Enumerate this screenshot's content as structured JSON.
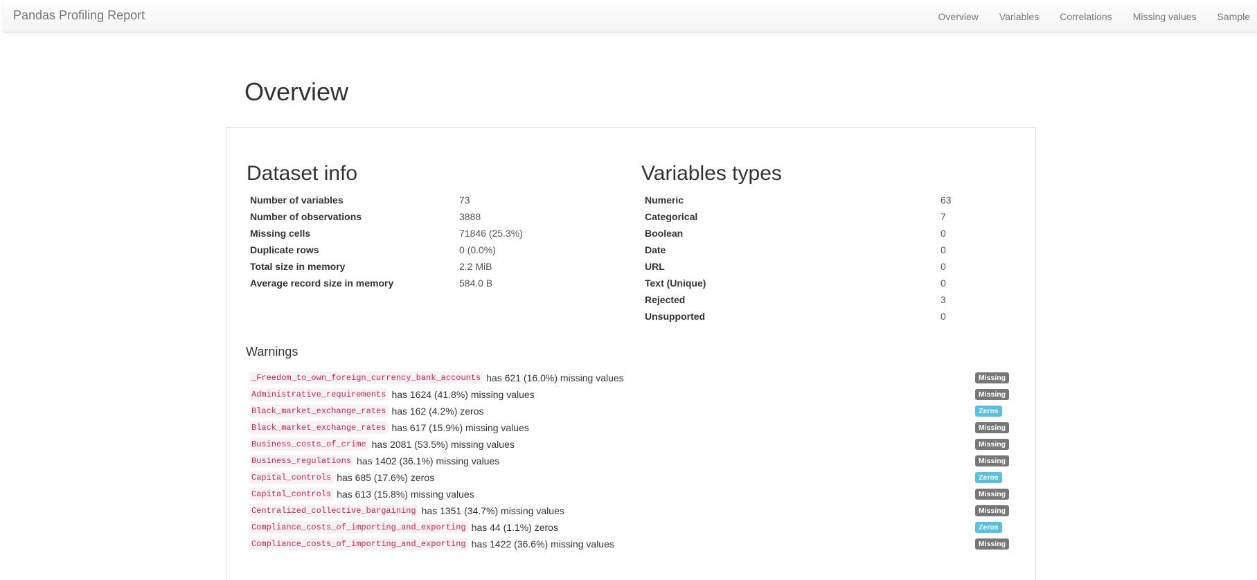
{
  "navbar": {
    "brand": "Pandas Profiling Report",
    "links": [
      "Overview",
      "Variables",
      "Correlations",
      "Missing values",
      "Sample"
    ]
  },
  "overview": {
    "title": "Overview",
    "dataset_info": {
      "title": "Dataset info",
      "rows": [
        {
          "label": "Number of variables",
          "value": "73"
        },
        {
          "label": "Number of observations",
          "value": "3888"
        },
        {
          "label": "Missing cells",
          "value": "71846 (25.3%)"
        },
        {
          "label": "Duplicate rows",
          "value": "0 (0.0%)"
        },
        {
          "label": "Total size in memory",
          "value": "2.2 MiB"
        },
        {
          "label": "Average record size in memory",
          "value": "584.0 B"
        }
      ]
    },
    "variable_types": {
      "title": "Variables types",
      "rows": [
        {
          "label": "Numeric",
          "value": "63"
        },
        {
          "label": "Categorical",
          "value": "7"
        },
        {
          "label": "Boolean",
          "value": "0"
        },
        {
          "label": "Date",
          "value": "0"
        },
        {
          "label": "URL",
          "value": "0"
        },
        {
          "label": "Text (Unique)",
          "value": "0"
        },
        {
          "label": "Rejected",
          "value": "3"
        },
        {
          "label": "Unsupported",
          "value": "0"
        }
      ]
    },
    "warnings": {
      "title": "Warnings",
      "items": [
        {
          "var": "_Freedom_to_own_foreign_currency_bank_accounts",
          "text": "has 621 (16.0%) missing values",
          "badge": "Missing",
          "kind": "missing"
        },
        {
          "var": "Administrative_requirements",
          "text": "has 1624 (41.8%) missing values",
          "badge": "Missing",
          "kind": "missing"
        },
        {
          "var": "Black_market_exchange_rates",
          "text": "has 162 (4.2%) zeros",
          "badge": "Zeros",
          "kind": "zeros"
        },
        {
          "var": "Black_market_exchange_rates",
          "text": "has 617 (15.9%) missing values",
          "badge": "Missing",
          "kind": "missing"
        },
        {
          "var": "Business_costs_of_crime",
          "text": "has 2081 (53.5%) missing values",
          "badge": "Missing",
          "kind": "missing"
        },
        {
          "var": "Business_regulations",
          "text": "has 1402 (36.1%) missing values",
          "badge": "Missing",
          "kind": "missing"
        },
        {
          "var": "Capital_controls",
          "text": "has 685 (17.6%) zeros",
          "badge": "Zeros",
          "kind": "zeros"
        },
        {
          "var": "Capital_controls",
          "text": "has 613 (15.8%) missing values",
          "badge": "Missing",
          "kind": "missing"
        },
        {
          "var": "Centralized_collective_bargaining",
          "text": "has 1351 (34.7%) missing values",
          "badge": "Missing",
          "kind": "missing"
        },
        {
          "var": "Compliance_costs_of_importing_and_exporting",
          "text": "has 44 (1.1%) zeros",
          "badge": "Zeros",
          "kind": "zeros"
        },
        {
          "var": "Compliance_costs_of_importing_and_exporting",
          "text": "has 1422 (36.6%) missing values",
          "badge": "Missing",
          "kind": "missing"
        }
      ]
    }
  }
}
